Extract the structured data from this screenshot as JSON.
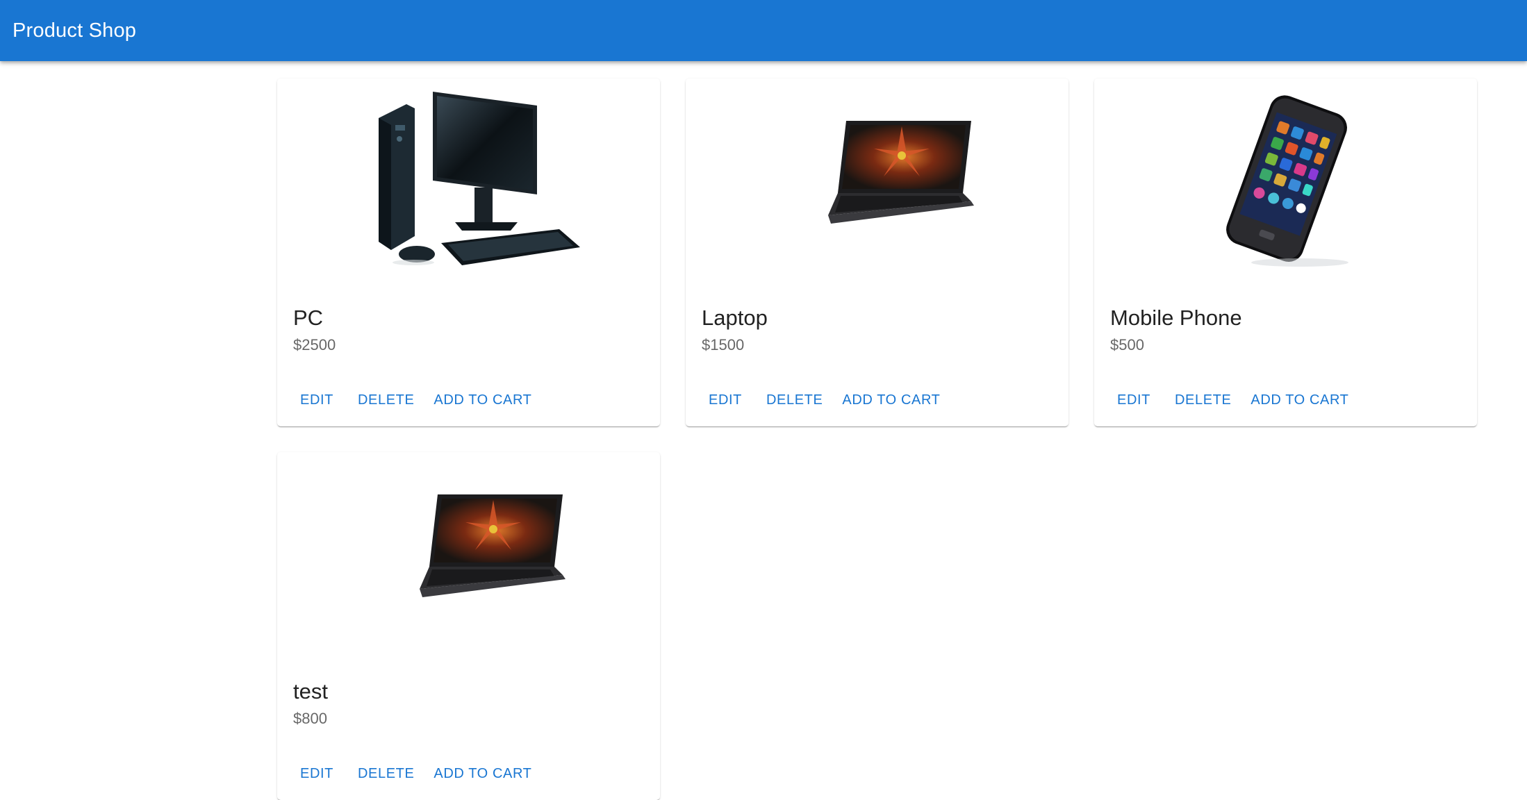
{
  "app": {
    "title": "Product Shop"
  },
  "actions": {
    "edit": "EDIT",
    "delete": "DELETE",
    "add_to_cart": "ADD TO CART"
  },
  "products": [
    {
      "name": "PC",
      "price": "$2500",
      "image_icon": "desktop-pc-icon"
    },
    {
      "name": "Laptop",
      "price": "$1500",
      "image_icon": "laptop-icon"
    },
    {
      "name": "Mobile Phone",
      "price": "$500",
      "image_icon": "smartphone-icon"
    },
    {
      "name": "test",
      "price": "$800",
      "image_icon": "laptop-icon"
    }
  ],
  "colors": {
    "primary": "#1976d2",
    "appbar_text": "#ffffff"
  }
}
